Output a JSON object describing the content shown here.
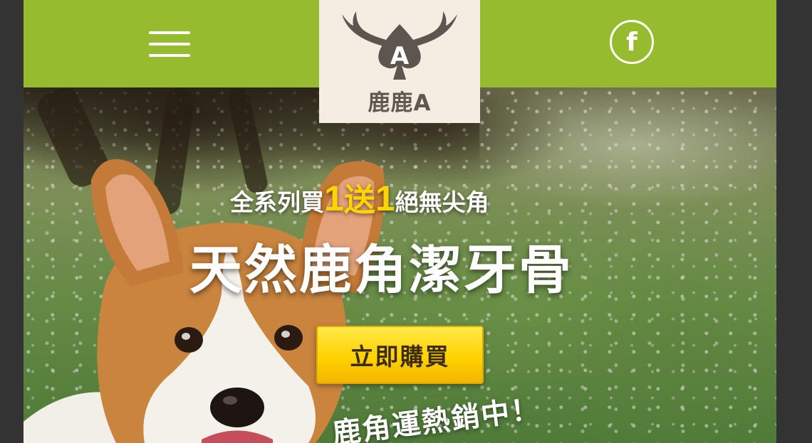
{
  "navbar": {
    "brand_name": "鹿鹿A",
    "logo_letter": "A",
    "menu_icon": "hamburger-menu-icon",
    "social_icon": "facebook-icon",
    "social_glyph": "f",
    "bg_color": "#97bb2f"
  },
  "hero": {
    "promo_prefix": "全系列買",
    "promo_num1": "1",
    "promo_word": "送",
    "promo_num2": "1",
    "promo_suffix": "絕無尖角",
    "headline": "天然鹿角潔牙骨",
    "buy_button_label": "立即購買",
    "bottom_text": "鹿角運熱銷中！",
    "highlight_color": "#ffd400",
    "button_color": "#ffd200"
  }
}
